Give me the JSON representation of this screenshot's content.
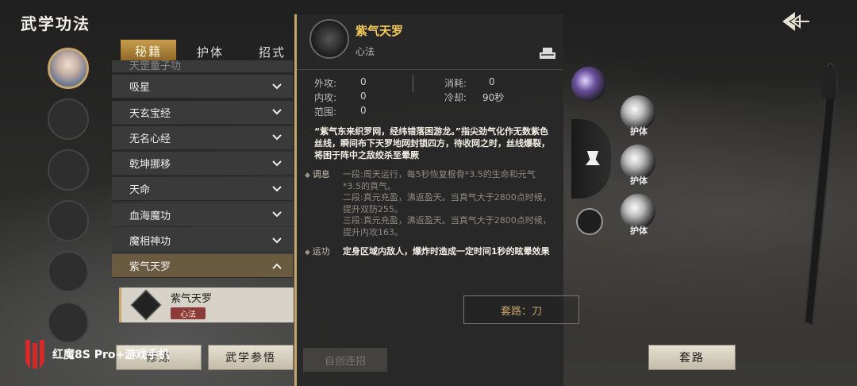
{
  "window": {
    "title": "武学功法"
  },
  "tabs": [
    {
      "label": "秘籍",
      "active": true
    },
    {
      "label": "护体",
      "active": false
    },
    {
      "label": "招式",
      "active": false
    }
  ],
  "list": {
    "items": [
      {
        "label": "天罡童子功",
        "state": "partial"
      },
      {
        "label": "吸星"
      },
      {
        "label": "天玄宝经"
      },
      {
        "label": "无名心经"
      },
      {
        "label": "乾坤挪移"
      },
      {
        "label": "天命"
      },
      {
        "label": "血海魔功"
      },
      {
        "label": "魔相神功"
      },
      {
        "label": "紫气天罗",
        "state": "selected"
      }
    ],
    "sub_item": {
      "name": "紫气天罗",
      "tag": "心法"
    }
  },
  "detail": {
    "name": "紫气天罗",
    "type": "心法",
    "stats": {
      "wai_gong_label": "外攻:",
      "wai_gong": "0",
      "nei_gong_label": "内攻:",
      "nei_gong": "0",
      "range_label": "范围:",
      "range": "0",
      "cost_label": "消耗:",
      "cost": "0",
      "cooldown_label": "冷却:",
      "cooldown": "90秒"
    },
    "description": "“紫气东来织罗网，经纬错落困游龙。”指尖劲气化作无数紫色丝线，瞬间布下天罗地网封锁四方，待收网之时，丝线爆裂，将困于阵中之敌绞杀至晕厥",
    "tiaoxi_label": "调息",
    "tiaoxi_text": "一段:周天运行，每5秒恢复根骨*3.5的生命和元气*3.5的真气。\n二段:真元充盈，沸返盈天。当真气大于2800点时候，提升双防255。\n三段:真元充盈，沸返盈天。当真气大于2800点时候，提升内攻163。",
    "yunxing_label": "运功",
    "yunxing_text": "定身区域内敌人，爆炸时造成一定时间1秒的眩晕效果",
    "ghost_button": "自创连招"
  },
  "right": {
    "skill_labels": [
      "护体",
      "护体",
      "护体"
    ],
    "taolu_text": "套路：刀"
  },
  "buttons": {
    "xiulian": "修炼",
    "wuxue_canwu": "武学参悟",
    "taolu": "套路"
  },
  "watermark": {
    "text": "红魔8S Pro+游戏手机"
  },
  "colors": {
    "accent_gold": "#c8a56a",
    "skill_name": "#f3c95a"
  }
}
